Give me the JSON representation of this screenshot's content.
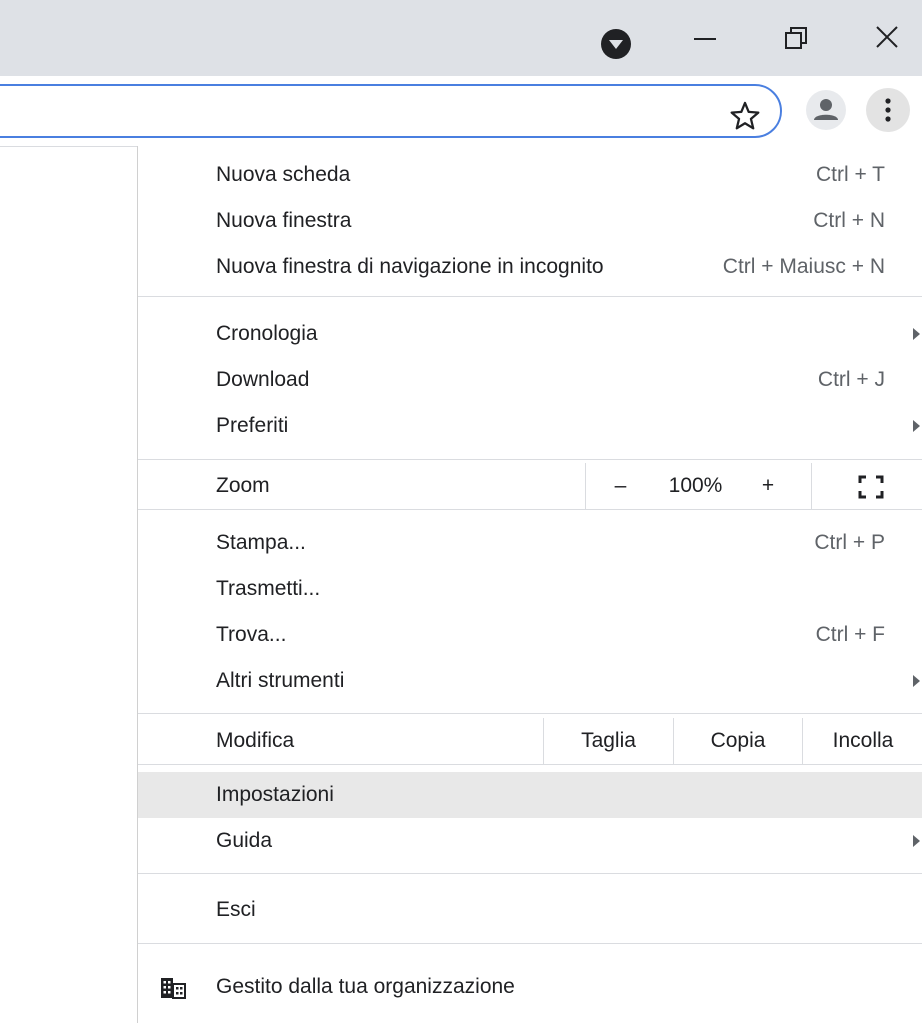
{
  "window_controls": {
    "dropdown_icon": "circle-down-triangle-icon",
    "minimize_icon": "minimize-icon",
    "restore_icon": "restore-icon",
    "close_icon": "close-icon"
  },
  "toolbar": {
    "bookmark_icon": "star-icon",
    "profile_icon": "person-icon",
    "menu_icon": "vertical-dots-icon"
  },
  "menu": {
    "section1": [
      {
        "label": "Nuova scheda",
        "shortcut": "Ctrl + T"
      },
      {
        "label": "Nuova finestra",
        "shortcut": "Ctrl + N"
      },
      {
        "label": "Nuova finestra di navigazione in incognito",
        "shortcut": "Ctrl + Maiusc + N"
      }
    ],
    "section2": [
      {
        "label": "Cronologia",
        "shortcut": ""
      },
      {
        "label": "Download",
        "shortcut": "Ctrl + J"
      },
      {
        "label": "Preferiti",
        "shortcut": ""
      }
    ],
    "zoom": {
      "label": "Zoom",
      "minus": "–",
      "value": "100%",
      "plus": "+",
      "fullscreen_icon": "fullscreen-icon"
    },
    "section3": [
      {
        "label": "Stampa...",
        "shortcut": "Ctrl + P"
      },
      {
        "label": "Trasmetti...",
        "shortcut": ""
      },
      {
        "label": "Trova...",
        "shortcut": "Ctrl + F"
      },
      {
        "label": "Altri strumenti",
        "shortcut": ""
      }
    ],
    "edit": {
      "label": "Modifica",
      "cut": "Taglia",
      "copy": "Copia",
      "paste": "Incolla"
    },
    "section4": [
      {
        "label": "Impostazioni"
      },
      {
        "label": "Guida"
      }
    ],
    "exit": {
      "label": "Esci"
    },
    "managed": {
      "label": "Gestito dalla tua organizzazione",
      "icon": "building-icon"
    }
  },
  "colors": {
    "titlebar": "#dee1e6",
    "omnibox_border": "#4a7fe0",
    "hover_row": "#e8e8e8",
    "separator": "#dadce0"
  }
}
